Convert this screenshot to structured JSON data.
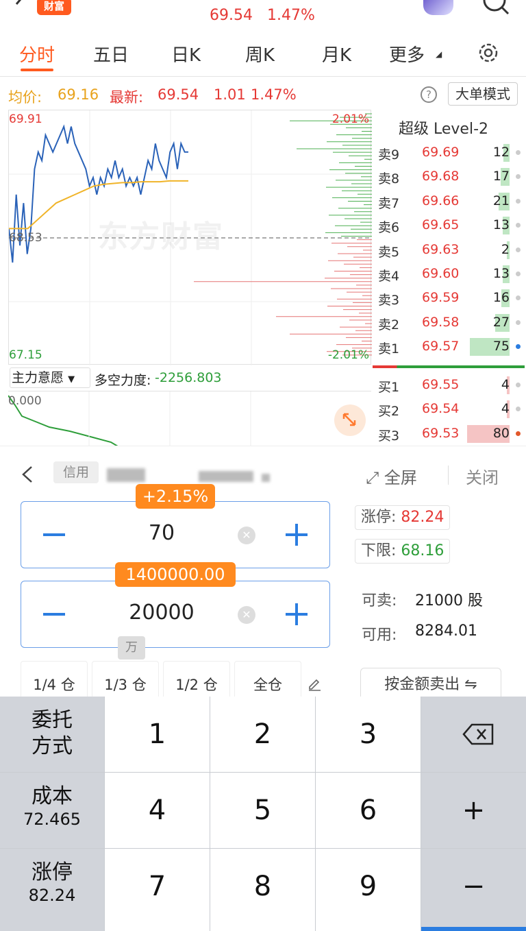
{
  "header": {
    "logo_text": "财富",
    "price": "69.54",
    "change_pct": "1.47%"
  },
  "tabs": [
    {
      "label": "分时",
      "active": true
    },
    {
      "label": "五日"
    },
    {
      "label": "日K"
    },
    {
      "label": "周K"
    },
    {
      "label": "月K"
    },
    {
      "label": "更多"
    }
  ],
  "info": {
    "avg_label": "均价:",
    "avg_value": "69.16",
    "last_label": "最新:",
    "last_value": "69.54",
    "change": "1.01",
    "change_pct": "1.47%",
    "help": "?",
    "big_order_mode": "大单模式"
  },
  "chart": {
    "y_top": "69.91",
    "y_mid": "68.53",
    "y_bottom": "67.15",
    "pct_top": "2.01%",
    "pct_bottom": "-2.01%",
    "watermark": "东方财富",
    "colors": {
      "price_line": "#2a62b8",
      "avg_line": "#f0b429",
      "up": "#e53935",
      "down": "#2e9e3a"
    }
  },
  "chart_data": {
    "type": "line",
    "ylim": [
      67.15,
      69.91
    ],
    "series": [
      {
        "name": "最新",
        "values": [
          68.6,
          68.2,
          69.0,
          68.4,
          68.9,
          68.3,
          68.6,
          69.3,
          69.5,
          69.4,
          69.7,
          69.6,
          69.5,
          69.6,
          69.7,
          69.8,
          69.6,
          69.8,
          69.6,
          69.5,
          69.4,
          69.3,
          69.1,
          69.2,
          69.0,
          69.2,
          69.1,
          69.3,
          69.2,
          69.4,
          69.2,
          69.3,
          69.1,
          69.2,
          69.1,
          69.2,
          69.0,
          69.2,
          69.4,
          69.3,
          69.6,
          69.4,
          69.3,
          69.2,
          69.5,
          69.6,
          69.3,
          69.6,
          69.5,
          69.5
        ]
      },
      {
        "name": "均价",
        "values": [
          68.6,
          68.6,
          68.6,
          68.7,
          68.8,
          68.9,
          68.95,
          69.0,
          69.05,
          69.1,
          69.12,
          69.13,
          69.14,
          69.14,
          69.15,
          69.15,
          69.15,
          69.16,
          69.16,
          69.16
        ]
      }
    ]
  },
  "indicator": {
    "name": "主力意愿",
    "label": "多空力度:",
    "value": "-2256.803",
    "zero": "0.000"
  },
  "order_book": {
    "title": "超级 Level-2",
    "asks": [
      {
        "label": "卖9",
        "price": "69.69",
        "vol": "12"
      },
      {
        "label": "卖8",
        "price": "69.68",
        "vol": "17"
      },
      {
        "label": "卖7",
        "price": "69.66",
        "vol": "21"
      },
      {
        "label": "卖6",
        "price": "69.65",
        "vol": "13"
      },
      {
        "label": "卖5",
        "price": "69.63",
        "vol": "2"
      },
      {
        "label": "卖4",
        "price": "69.60",
        "vol": "13"
      },
      {
        "label": "卖3",
        "price": "69.59",
        "vol": "16"
      },
      {
        "label": "卖2",
        "price": "69.58",
        "vol": "27"
      },
      {
        "label": "卖1",
        "price": "69.57",
        "vol": "75"
      }
    ],
    "bids": [
      {
        "label": "买1",
        "price": "69.55",
        "vol": "4"
      },
      {
        "label": "买2",
        "price": "69.54",
        "vol": "4"
      },
      {
        "label": "买3",
        "price": "69.53",
        "vol": "80"
      }
    ]
  },
  "trade": {
    "credit": "信用",
    "fullscreen": "全屏",
    "close": "关闭",
    "price_bubble": "+2.15%",
    "price": "70",
    "amount_bubble": "1400000.00",
    "qty": "20000",
    "unit": "万",
    "limit_up_label": "涨停:",
    "limit_up_value": "82.24",
    "lower_label": "下限:",
    "lower_value": "68.16",
    "sellable_label": "可卖:",
    "sellable_value": "21000 股",
    "available_label": "可用:",
    "available_value": "8284.01",
    "positions": [
      "1/4 仓",
      "1/3 仓",
      "1/2 仓",
      "全仓"
    ],
    "sell_by_amount": "按金额卖出 ⇋"
  },
  "keypad": {
    "order_type": "委托\n方式",
    "cost_label": "成本",
    "cost_value": "72.465",
    "limit_label": "涨停",
    "limit_value": "82.24",
    "digits": [
      "1",
      "2",
      "3",
      "4",
      "5",
      "6",
      "7",
      "8",
      "9"
    ],
    "plus": "+",
    "minus": "−"
  }
}
